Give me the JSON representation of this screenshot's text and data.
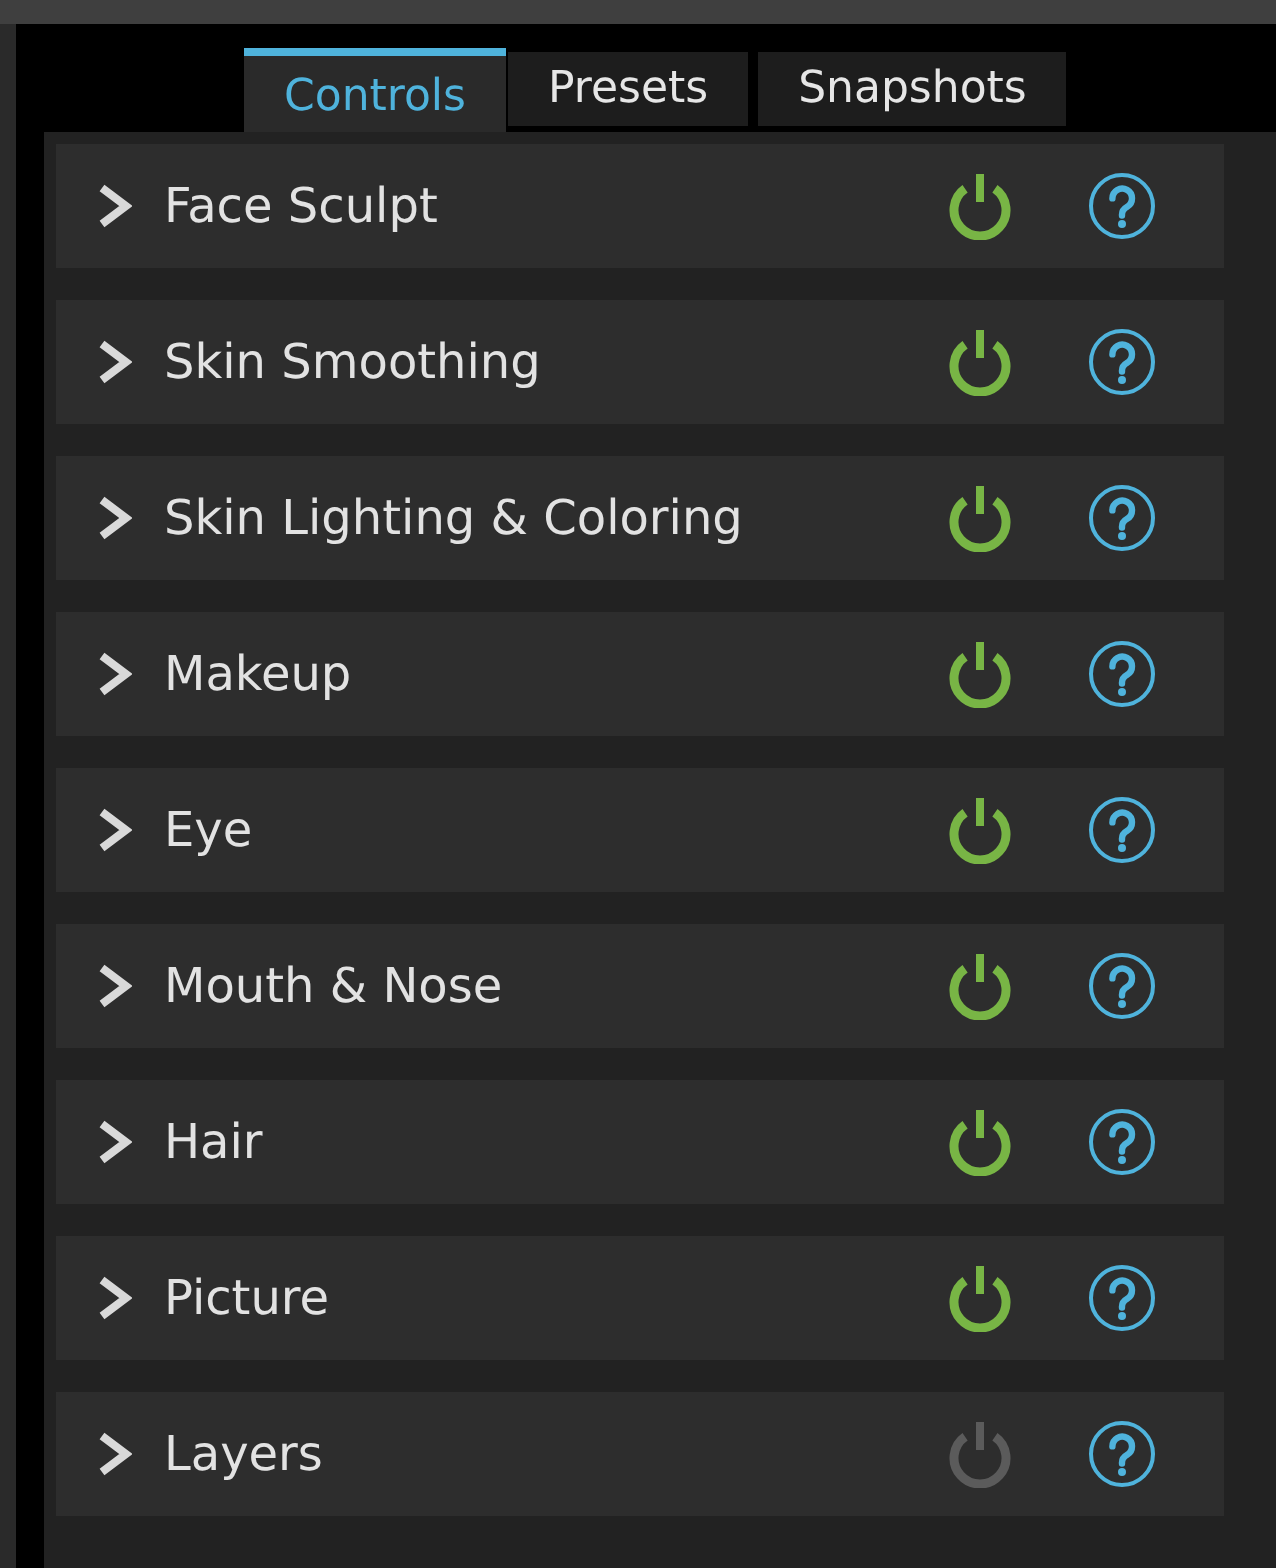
{
  "tabs": [
    {
      "label": "Controls",
      "selected": true
    },
    {
      "label": "Presets",
      "selected": false
    },
    {
      "label": "Snapshots",
      "selected": false
    }
  ],
  "effects": [
    {
      "name": "Face Sculpt",
      "expanded": false,
      "on": true
    },
    {
      "name": "Skin Smoothing",
      "expanded": false,
      "on": true
    },
    {
      "name": "Skin Lighting & Coloring",
      "expanded": false,
      "on": true
    },
    {
      "name": "Makeup",
      "expanded": false,
      "on": true
    },
    {
      "name": "Eye",
      "expanded": false,
      "on": true
    },
    {
      "name": "Mouth & Nose",
      "expanded": false,
      "on": true
    },
    {
      "name": "Hair",
      "expanded": false,
      "on": true
    },
    {
      "name": "Picture",
      "expanded": false,
      "on": true
    },
    {
      "name": "Layers",
      "expanded": false,
      "on": false
    }
  ]
}
